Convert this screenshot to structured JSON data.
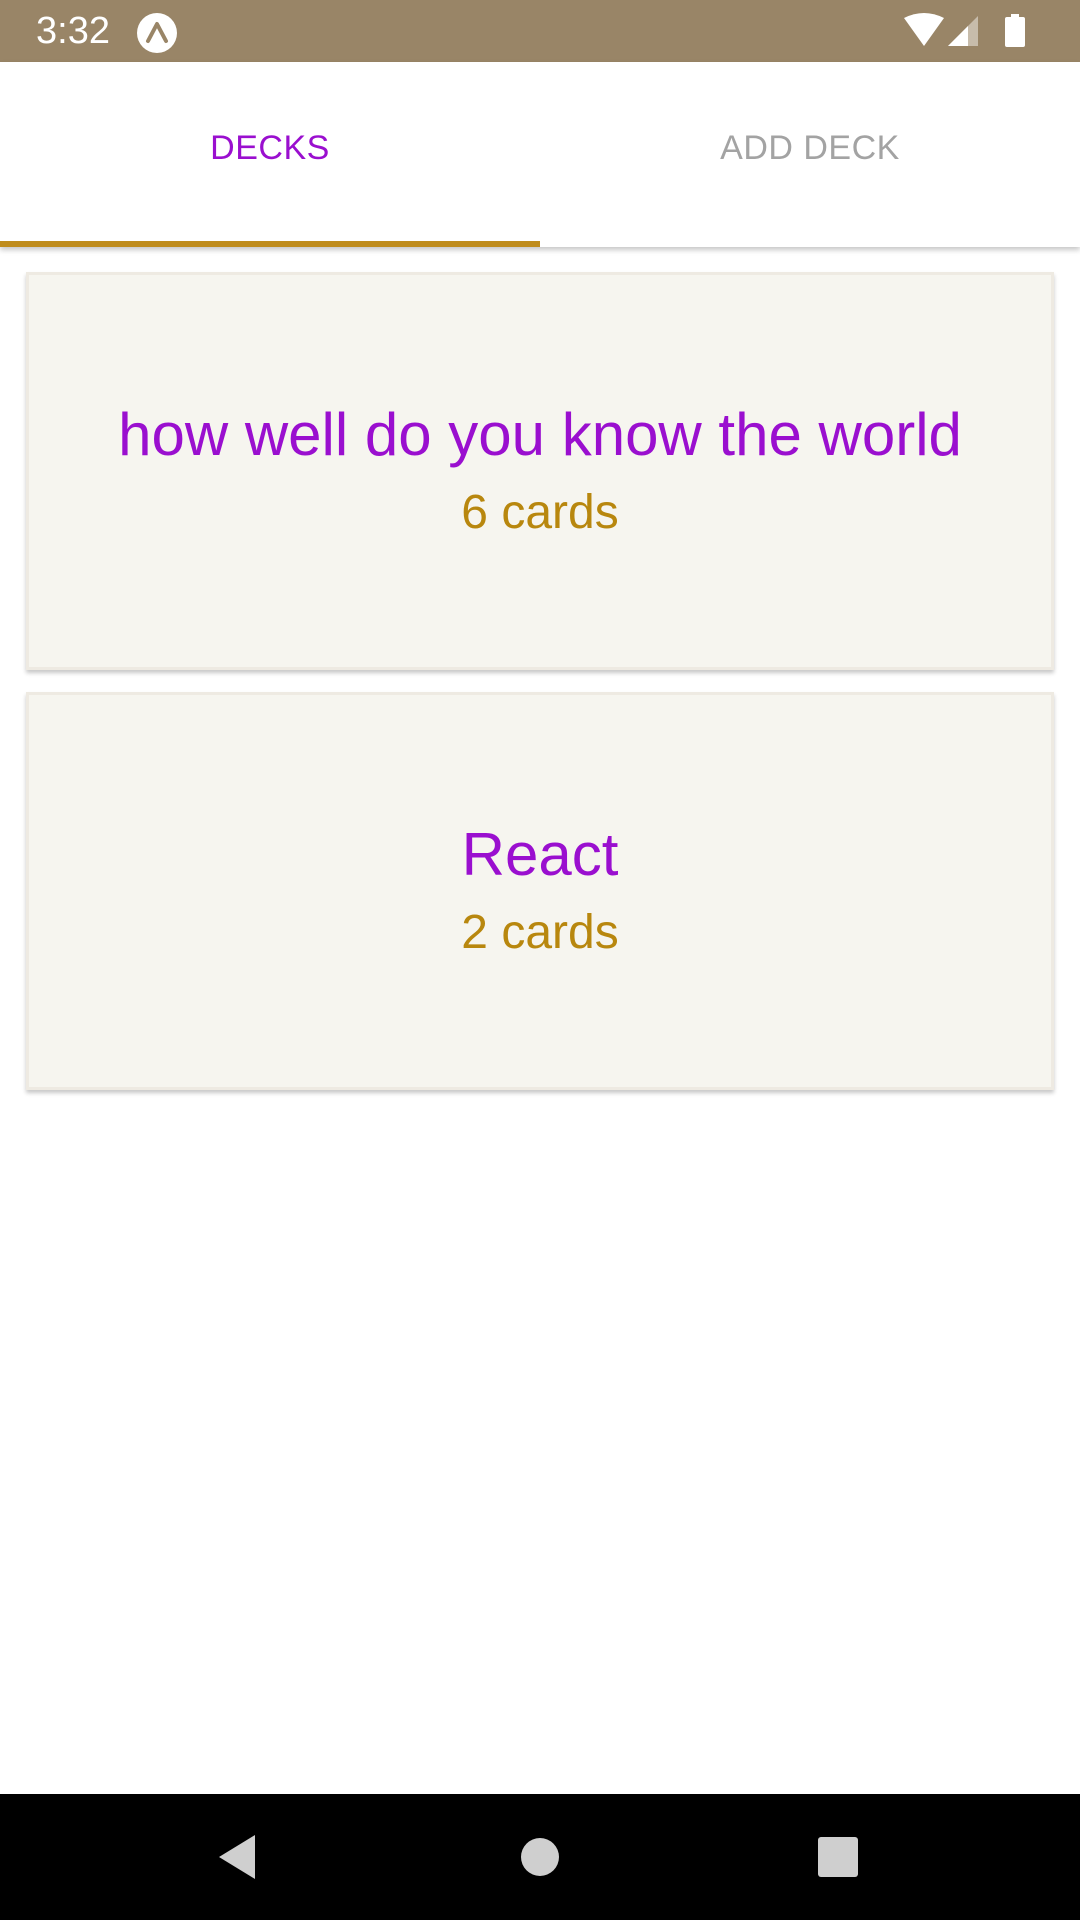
{
  "status_bar": {
    "time": "3:32",
    "background": "#998567",
    "icons": [
      "expo-icon",
      "wifi-icon",
      "cellular-signal-icon",
      "battery-icon"
    ]
  },
  "tabs": {
    "items": [
      {
        "label": "DECKS",
        "active": true
      },
      {
        "label": "ADD DECK",
        "active": false
      }
    ],
    "active_color": "#9a0fcf",
    "inactive_color": "#a3a3a3",
    "indicator_color": "#bf8c1c"
  },
  "decks": [
    {
      "title": "how well do you know the world",
      "count": "6 cards"
    },
    {
      "title": "React",
      "count": "2 cards"
    }
  ],
  "colors": {
    "card_background": "#f6f5ef",
    "deck_title": "#9a0fcf",
    "deck_count": "#b8870e"
  },
  "nav_bar": {
    "icons": [
      "back-icon",
      "home-icon",
      "recent-apps-icon"
    ]
  }
}
